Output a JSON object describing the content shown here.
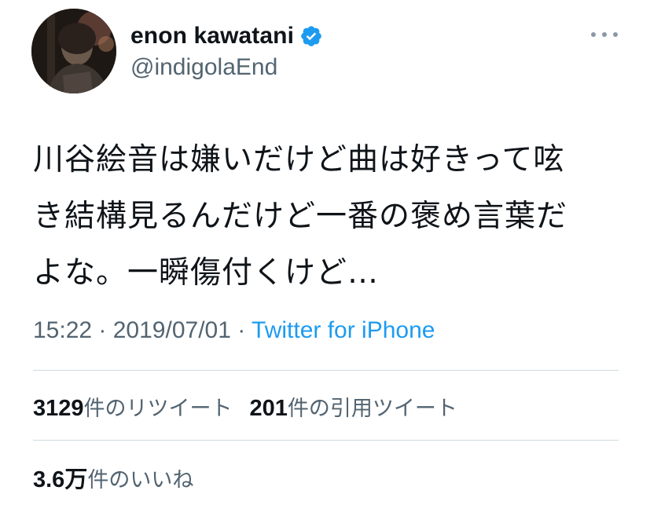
{
  "user": {
    "display_name": "enon kawatani",
    "handle": "@indigolaEnd"
  },
  "tweet": {
    "text": "川谷絵音は嫌いだけど曲は好きって呟\nき結構見るんだけど一番の褒め言葉だ\nよな。一瞬傷付くけど…",
    "time": "15:22",
    "date": "2019/07/01",
    "separator": " · ",
    "source": "Twitter for iPhone"
  },
  "stats": {
    "retweets_count": "3129",
    "retweets_label": "件のリツイート",
    "quotes_count": "201",
    "quotes_label": "件の引用ツイート",
    "likes_count": "3.6万",
    "likes_label": "件のいいね"
  },
  "colors": {
    "text": "#0f1419",
    "secondary": "#536471",
    "link": "#1d9bf0",
    "verified": "#1d9bf0",
    "divider": "#cfd9de"
  },
  "icons": [
    "avatar",
    "verified-badge-icon",
    "more-options-icon"
  ]
}
